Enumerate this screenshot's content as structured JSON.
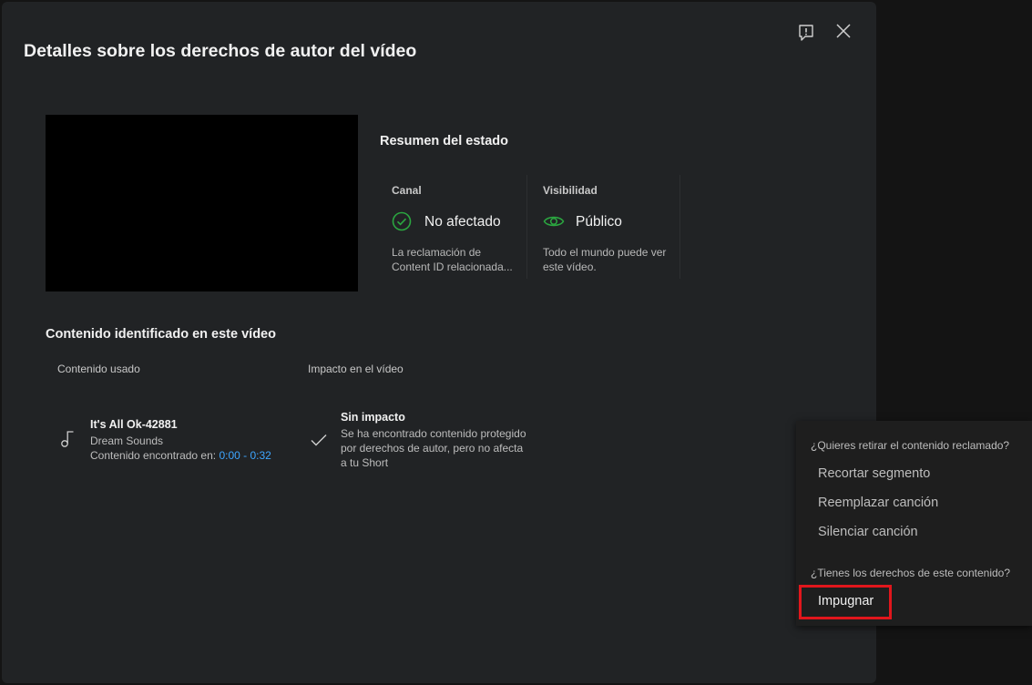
{
  "dialog": {
    "title": "Detalles sobre los derechos de autor del vídeo",
    "report_icon": "feedback-flag-icon",
    "close_icon": "close-icon"
  },
  "status_summary": {
    "heading": "Resumen del estado",
    "channel": {
      "label": "Canal",
      "value": "No afectado",
      "icon": "check-circle-icon",
      "description_line1": "La reclamación de",
      "description_line2": "Content ID relacionada..."
    },
    "visibility": {
      "label": "Visibilidad",
      "value": "Público",
      "icon": "eye-icon",
      "description_line1": "Todo el mundo puede ver",
      "description_line2": "este vídeo."
    }
  },
  "identified": {
    "heading": "Contenido identificado en este vídeo",
    "columns": [
      "Contenido usado",
      "Impacto en el vídeo"
    ],
    "item": {
      "icon": "music-note-icon",
      "title": "It's All Ok-42881",
      "artist": "Dream Sounds",
      "found_label": "Contenido encontrado en: ",
      "time_range": "0:00 - 0:32"
    },
    "impact": {
      "icon": "checkmark-icon",
      "title": "Sin impacto",
      "line1": "Se ha encontrado contenido protegido",
      "line2": "por derechos de autor, pero no afecta",
      "line3": "a tu Short"
    }
  },
  "options_menu": {
    "remove_question": "¿Quieres retirar el contenido reclamado?",
    "items": [
      "Recortar segmento",
      "Reemplazar canción",
      "Silenciar canción"
    ],
    "rights_question": "¿Tienes los derechos de este contenido?",
    "dispute_label": "Impugnar"
  },
  "colors": {
    "accent_green": "#2ba640",
    "link_blue": "#3ea6ff",
    "highlight_red": "#e1161c"
  }
}
